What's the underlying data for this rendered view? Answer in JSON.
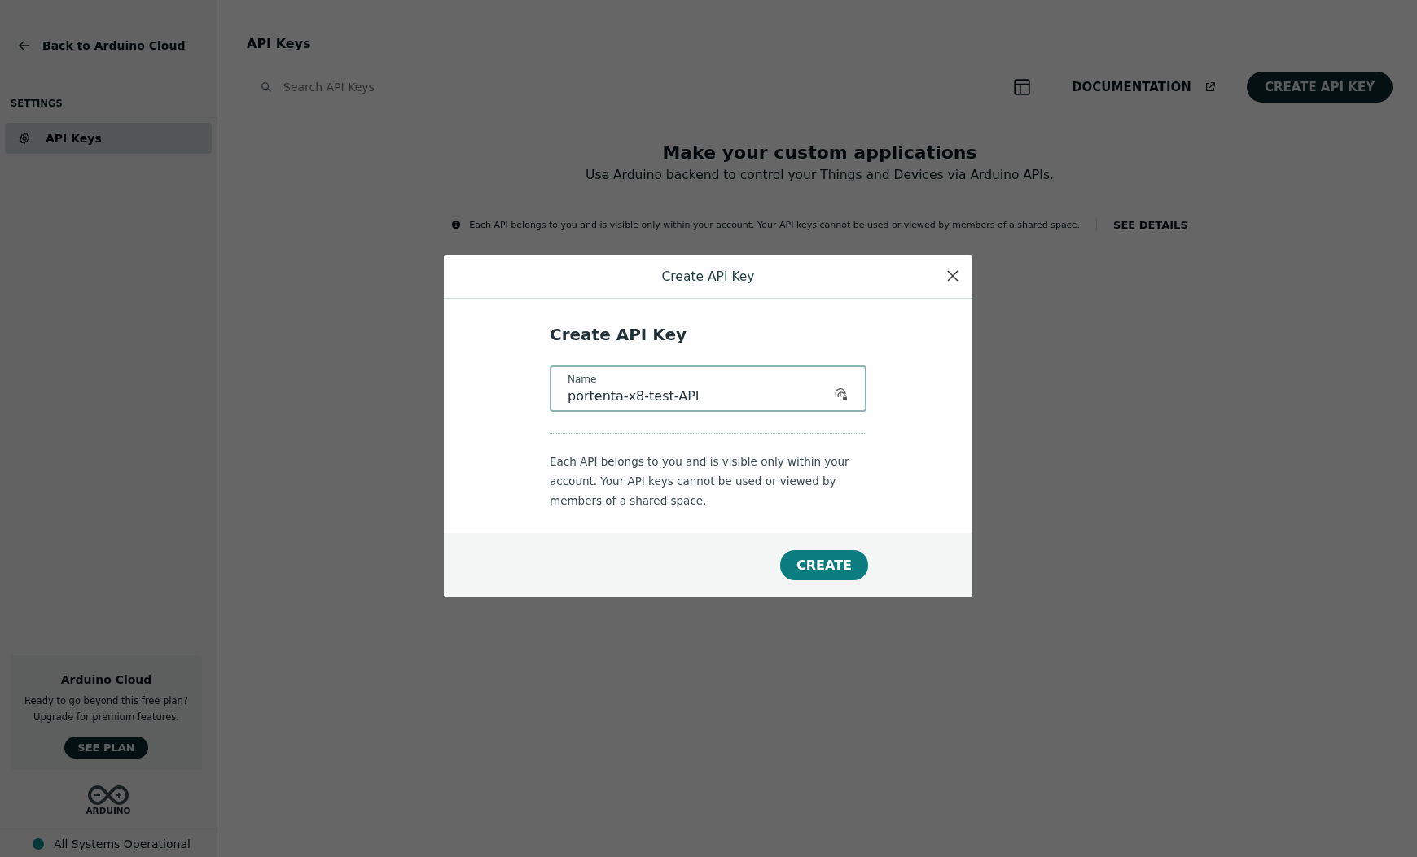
{
  "sidebar": {
    "back_link": "Back to Arduino Cloud",
    "section_label": "SETTINGS",
    "items": [
      {
        "label": "API Keys",
        "selected": true
      }
    ],
    "promo": {
      "title": "Arduino Cloud",
      "lines": [
        "Ready to go beyond this free plan?",
        "Upgrade for premium features."
      ],
      "button": "SEE PLAN"
    },
    "logo_text": "ARDUINO",
    "status": "All Systems Operational"
  },
  "page": {
    "title": "API Keys",
    "search": {
      "placeholder": "Search API Keys"
    },
    "documentation_link": "DOCUMENTATION",
    "create_button": "CREATE API KEY",
    "heading": "Make your custom applications",
    "subheading": "Use Arduino backend to control your Things and Devices via Arduino APIs.",
    "info": "Each API belongs to you and is visible only within your account. Your API keys cannot be used or viewed by members of a shared space.",
    "info_link": "SEE DETAILS"
  },
  "dialog": {
    "title": "Create API Key",
    "heading": "Create API Key",
    "field": {
      "label": "Name",
      "value": "portenta-x8-test-API"
    },
    "text": "Each API belongs to you and is visible only within your account. Your API keys cannot be used or viewed by members of a shared space.",
    "button": "CREATE"
  }
}
